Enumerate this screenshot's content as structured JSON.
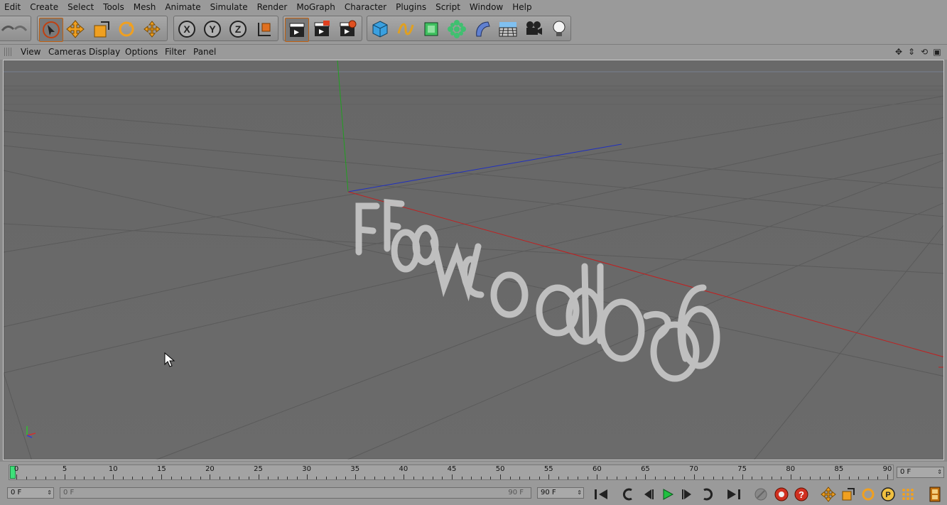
{
  "menu": [
    "Edit",
    "Create",
    "Select",
    "Tools",
    "Mesh",
    "Animate",
    "Simulate",
    "Render",
    "MoGraph",
    "Character",
    "Plugins",
    "Script",
    "Window",
    "Help"
  ],
  "viewport_menu": [
    "View",
    "Cameras",
    "Display",
    "Options",
    "Filter",
    "Panel"
  ],
  "scene_text": "Flowcode6",
  "timeline": {
    "ticks": [
      "0",
      "5",
      "10",
      "15",
      "20",
      "25",
      "30",
      "35",
      "40",
      "45",
      "50",
      "55",
      "60",
      "65",
      "70",
      "75",
      "80",
      "85",
      "90"
    ],
    "current_frame_display": "0 F",
    "start_field": "0 F",
    "range_start": "0 F",
    "range_end": "90 F",
    "end_field": "90 F"
  },
  "colors": {
    "x_axis": "#c02020",
    "y_axis": "#20a020",
    "z_axis": "#2030c0",
    "accent_orange": "#f0a020",
    "play_green": "#20c040"
  }
}
